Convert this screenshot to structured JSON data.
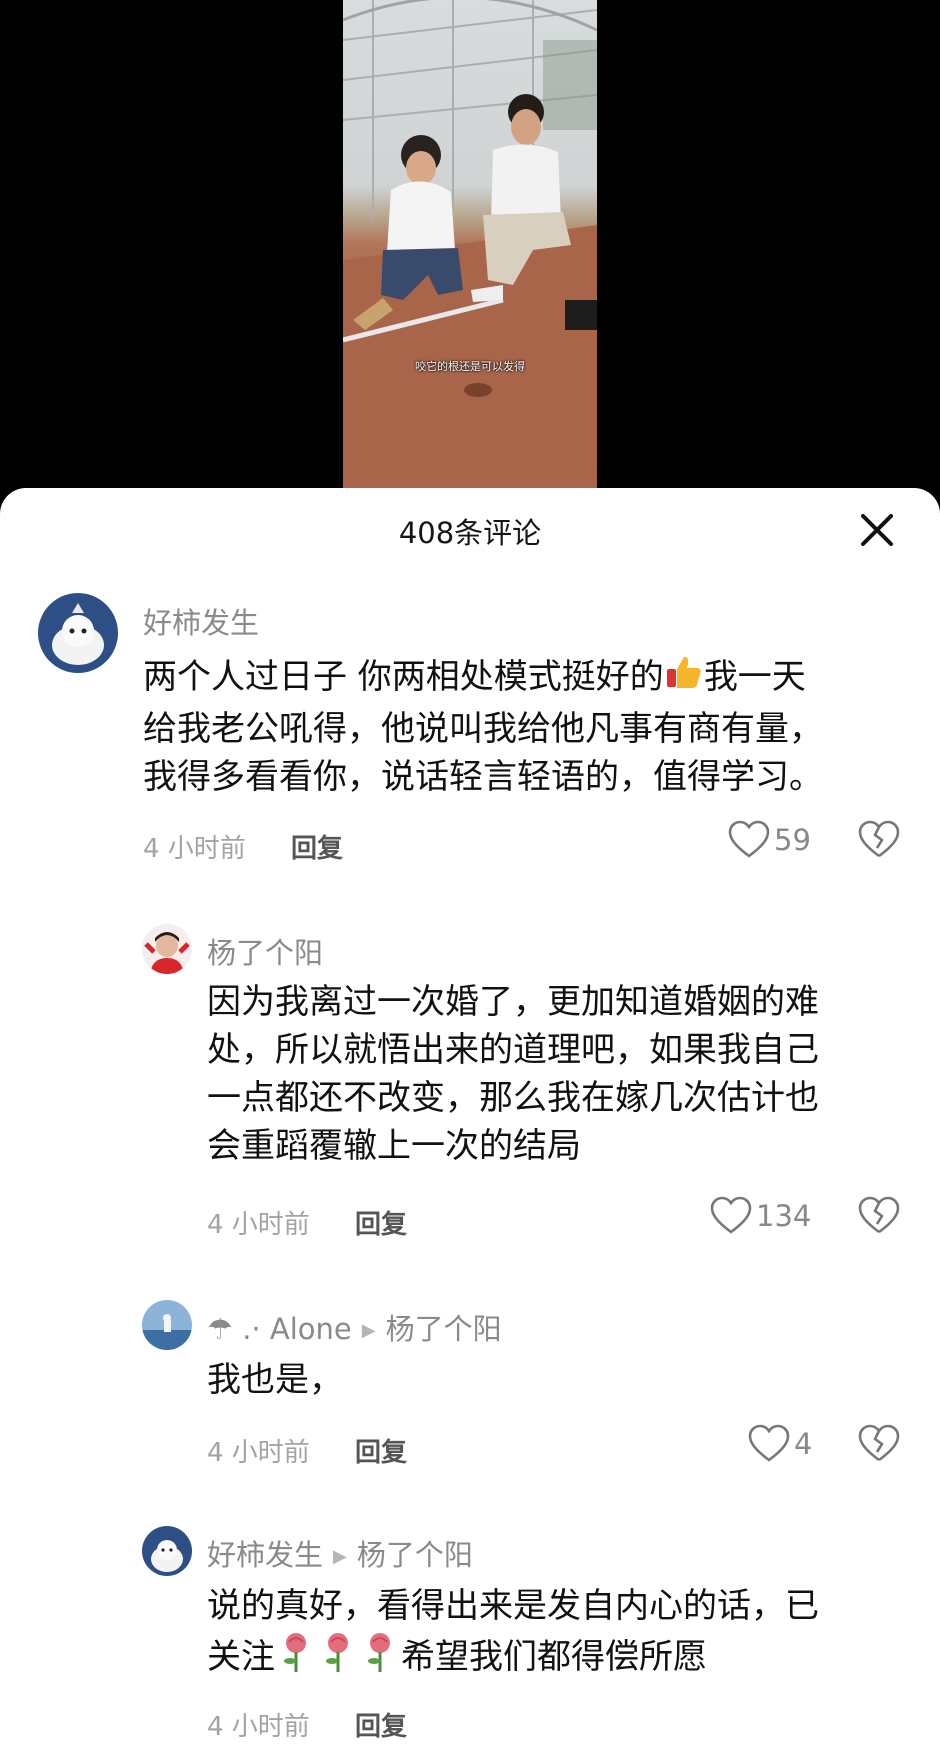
{
  "video": {
    "subtitle": "咬它的根还是可以发得"
  },
  "sheet": {
    "title": "408条评论"
  },
  "comments": [
    {
      "author": "好柿发生",
      "lines": [
        "两个人过日子 你两相处模式挺好的",
        "我一天",
        "给我老公吼得，他说叫我给他凡事有商有量，",
        "我得多看看你，说话轻言轻语的，值得学习。"
      ],
      "time": "4 小时前",
      "reply": "回复",
      "likes": "59"
    },
    {
      "author": "杨了个阳",
      "lines": [
        "因为我离过一次婚了，更加知道婚姻的难",
        "处，所以就悟出来的道理吧，如果我自己",
        "一点都还不改变，那么我在嫁几次估计也",
        "会重蹈覆辙上一次的结局"
      ],
      "time": "4 小时前",
      "reply": "回复",
      "likes": "134"
    },
    {
      "author": "☂ .· Alone",
      "reply_to": "杨了个阳",
      "lines": [
        "我也是，"
      ],
      "time": "4 小时前",
      "reply": "回复",
      "likes": "4"
    },
    {
      "author": "好柿发生",
      "reply_to": "杨了个阳",
      "lines": [
        "说的真好，看得出来是发自内心的话，已",
        "关注",
        "希望我们都得偿所愿"
      ],
      "time": "4 小时前",
      "reply": "回复"
    }
  ],
  "colors": {
    "sheet_bg": "#ffffff",
    "author": "#8a8a8a",
    "meta": "#a3a3a3",
    "text": "#111111"
  },
  "icons": [
    "close-icon",
    "heart-icon",
    "broken-heart-icon",
    "thumbs-up-emoji",
    "rose-emoji"
  ]
}
